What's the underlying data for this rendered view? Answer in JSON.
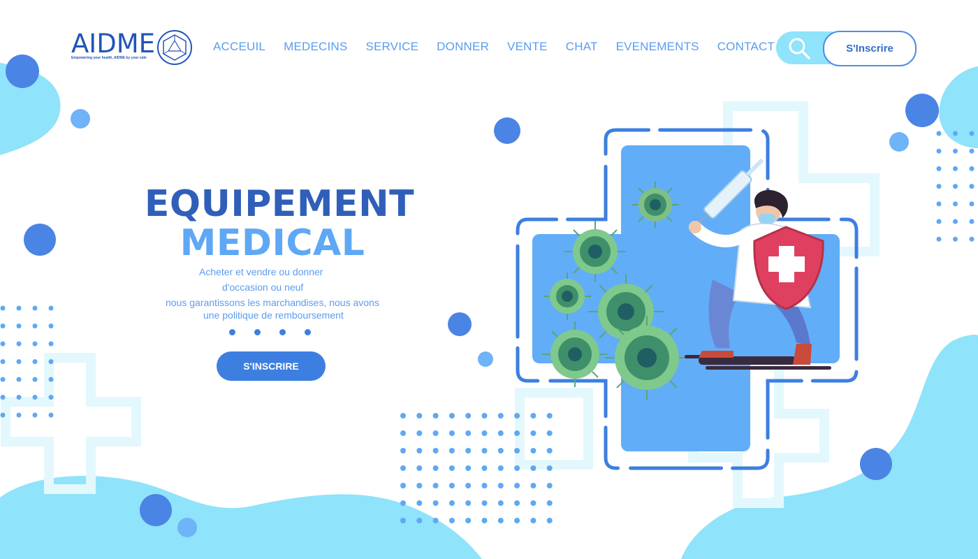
{
  "brand": {
    "name": "AIDME",
    "tagline": "Empowering your health, AIDME by your side"
  },
  "nav": {
    "items": [
      "ACCEUIL",
      "MEDECINS",
      "SERVICE",
      "DONNER",
      "VENTE",
      "CHAT",
      "EVENEMENTS",
      "CONTACT"
    ]
  },
  "header": {
    "signup_label": "S'Inscrire",
    "search_icon": "search-icon"
  },
  "hero": {
    "title_line1": "EQUIPEMENT",
    "title_line2": "MEDICAL",
    "desc_line1": "Acheter et vendre ou donner",
    "desc_line2": "d'occasion ou neuf",
    "desc_line3": "nous garantissons les marchandises, nous avons",
    "desc_line4": "une politique de remboursement",
    "cta_label": "S'INSCRIRE",
    "carousel_count": 4
  },
  "colors": {
    "primary": "#3d7fe0",
    "light_blue": "#5ea8f5",
    "cyan_blob": "#8fe3fa",
    "dark_title": "#2f5fb8",
    "shield_red": "#e0405f"
  }
}
